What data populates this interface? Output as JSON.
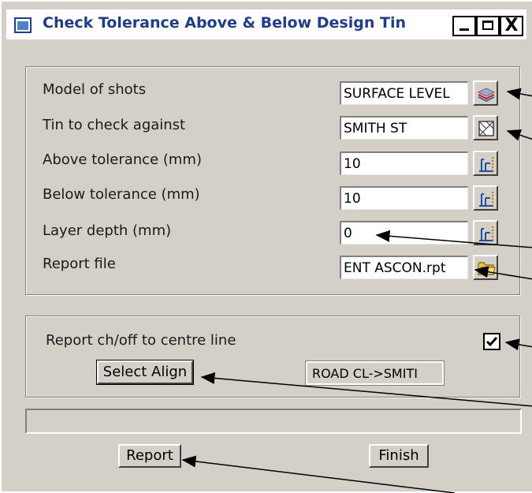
{
  "window": {
    "title": "Check Tolerance Above & Below Design Tin",
    "close_glyph": "X"
  },
  "fields": {
    "model_of_shots": {
      "label": "Model of shots",
      "value": "SURFACE LEVEL"
    },
    "tin_to_check": {
      "label": "Tin to check against",
      "value": "SMITH ST"
    },
    "above_tolerance": {
      "label": "Above tolerance (mm)",
      "value": "10"
    },
    "below_tolerance": {
      "label": "Below tolerance (mm)",
      "value": "10"
    },
    "layer_depth": {
      "label": "Layer depth (mm)",
      "value": "0"
    },
    "report_file": {
      "label": "Report file",
      "value": "ENT ASCON.rpt"
    }
  },
  "options": {
    "report_chainage_label": "Report ch/off to centre line",
    "report_chainage_checked": true,
    "select_align_label": "Select Align",
    "alignment_value": "ROAD CL->SMITI"
  },
  "buttons": {
    "report": "Report",
    "finish": "Finish"
  },
  "icons": {
    "model": "layers-icon",
    "tin": "tin-icon",
    "calc": "calculator-icon",
    "folder": "folder-icon",
    "arrows": "annotation-arrow-icon"
  }
}
